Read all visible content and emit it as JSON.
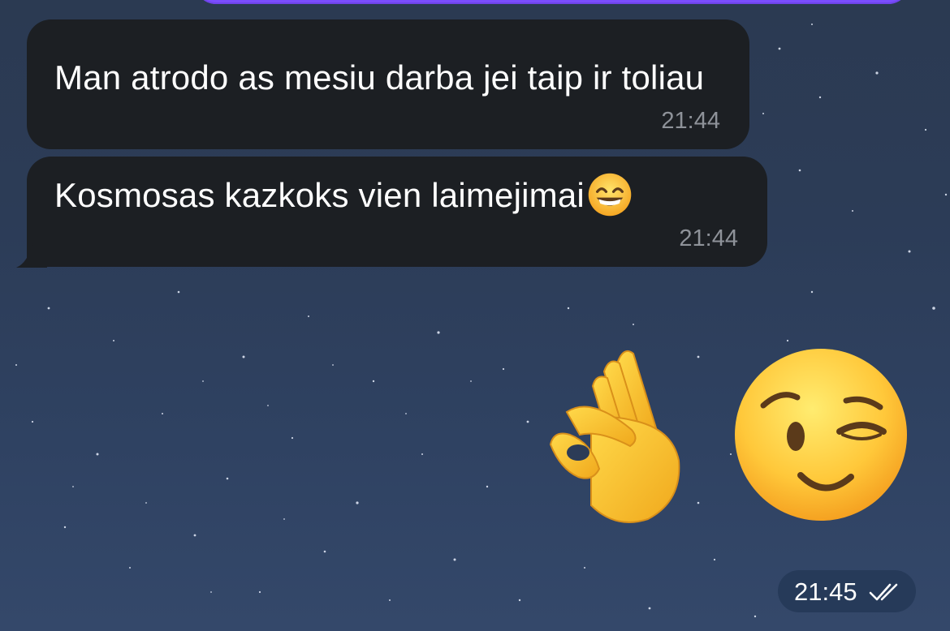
{
  "messages": [
    {
      "text": "Man atrodo as mesiu darba jei taip ir toliau",
      "time": "21:44",
      "emoji": ""
    },
    {
      "text": "Kosmosas kazkoks vien laimejimai",
      "time": "21:44",
      "emoji": "grinning-face-with-smiling-eyes"
    }
  ],
  "outgoing": {
    "emojis": [
      "ok-hand",
      "winking-face"
    ],
    "time": "21:45",
    "status": "read-double-check"
  },
  "colors": {
    "incoming_bubble": "#1c1f23",
    "outgoing_bubble_accent": "#7b4dff",
    "timestamp_gray": "#8e9299",
    "background_top": "#2b3a52",
    "background_bottom": "#34486a",
    "time_pill": "#253a58"
  }
}
